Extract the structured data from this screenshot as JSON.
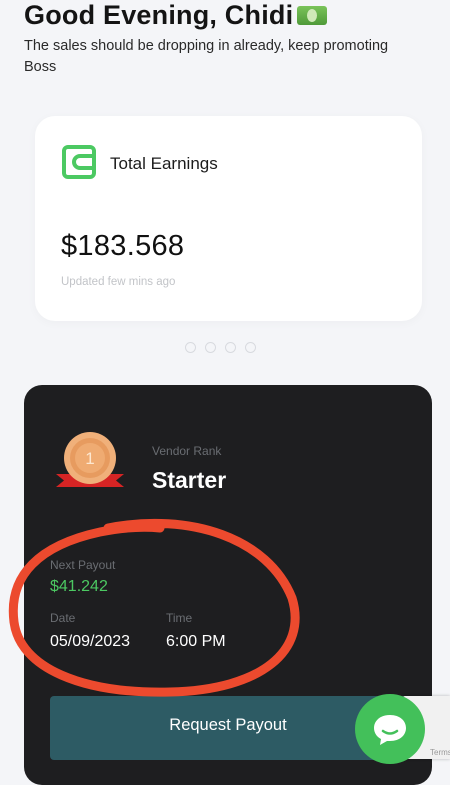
{
  "header": {
    "greeting": "Good Evening, Chidi",
    "emoji": "money-icon",
    "subtitle": "The sales should be dropping in already, keep promoting Boss"
  },
  "earnings": {
    "icon": "wallet-icon",
    "title": "Total Earnings",
    "amount": "$183.568",
    "updated": "Updated few mins ago",
    "accent_color": "#4cc962"
  },
  "carousel": {
    "dot_count": 4
  },
  "vendor": {
    "medal_icon": "rank-medal-icon",
    "medal_number": "1",
    "rank_label": "Vendor Rank",
    "rank_value": "Starter",
    "next_payout_label": "Next Payout",
    "next_payout_value": "$41.242",
    "date_label": "Date",
    "date_value": "05/09/2023",
    "time_label": "Time",
    "time_value": "6:00 PM",
    "request_button": "Request Payout"
  },
  "chat": {
    "icon": "chat-bubble-icon"
  },
  "recaptcha": {
    "label": "Terms"
  },
  "colors": {
    "background": "#f4f5f8",
    "card_dark": "#1e1e20",
    "payout_green": "#4cc962",
    "button_teal": "#2d5b64",
    "annotation_red": "#ec4a2e",
    "chat_green": "#43c05a"
  }
}
